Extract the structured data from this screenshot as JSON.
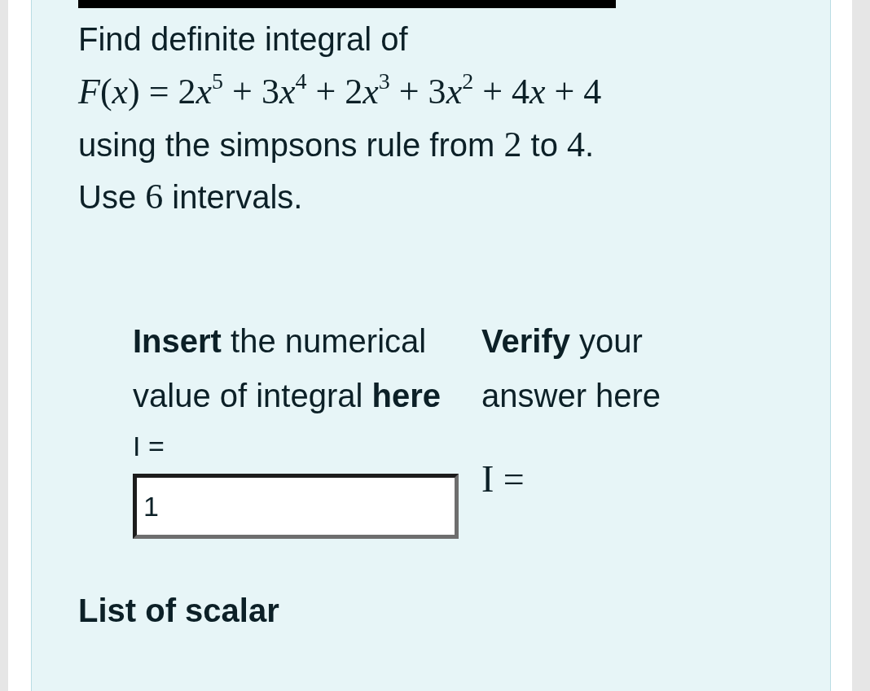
{
  "problem": {
    "intro": "Find definite integral of",
    "formula": [
      {
        "kind": "var",
        "text": "F"
      },
      {
        "kind": "num",
        "text": "("
      },
      {
        "kind": "var",
        "text": "x"
      },
      {
        "kind": "num",
        "text": ") = 2"
      },
      {
        "kind": "var",
        "text": "x"
      },
      {
        "kind": "sup",
        "text": "5"
      },
      {
        "kind": "num",
        "text": " + 3"
      },
      {
        "kind": "var",
        "text": "x"
      },
      {
        "kind": "sup",
        "text": "4"
      },
      {
        "kind": "num",
        "text": " + 2"
      },
      {
        "kind": "var",
        "text": "x"
      },
      {
        "kind": "sup",
        "text": "3"
      },
      {
        "kind": "num",
        "text": " + 3"
      },
      {
        "kind": "var",
        "text": "x"
      },
      {
        "kind": "sup",
        "text": "2"
      },
      {
        "kind": "num",
        "text": " + 4"
      },
      {
        "kind": "var",
        "text": "x"
      },
      {
        "kind": "num",
        "text": " + 4"
      }
    ],
    "lines": [
      [
        {
          "kind": "text",
          "text": "using the simpsons rule from "
        },
        {
          "kind": "math",
          "text": "2"
        },
        {
          "kind": "text",
          "text": " to "
        },
        {
          "kind": "math",
          "text": "4"
        },
        {
          "kind": "text",
          "text": "."
        }
      ],
      [
        {
          "kind": "text",
          "text": "Use "
        },
        {
          "kind": "math",
          "text": "6"
        },
        {
          "kind": "text",
          "text": " intervals."
        }
      ]
    ]
  },
  "answer": {
    "instruction": "**Insert** the numerical value of integral **here**",
    "label": "I =",
    "value": "1"
  },
  "verify": {
    "instruction": "**Verify** your answer here",
    "preview": "I ="
  },
  "next_section": "List of scalar"
}
